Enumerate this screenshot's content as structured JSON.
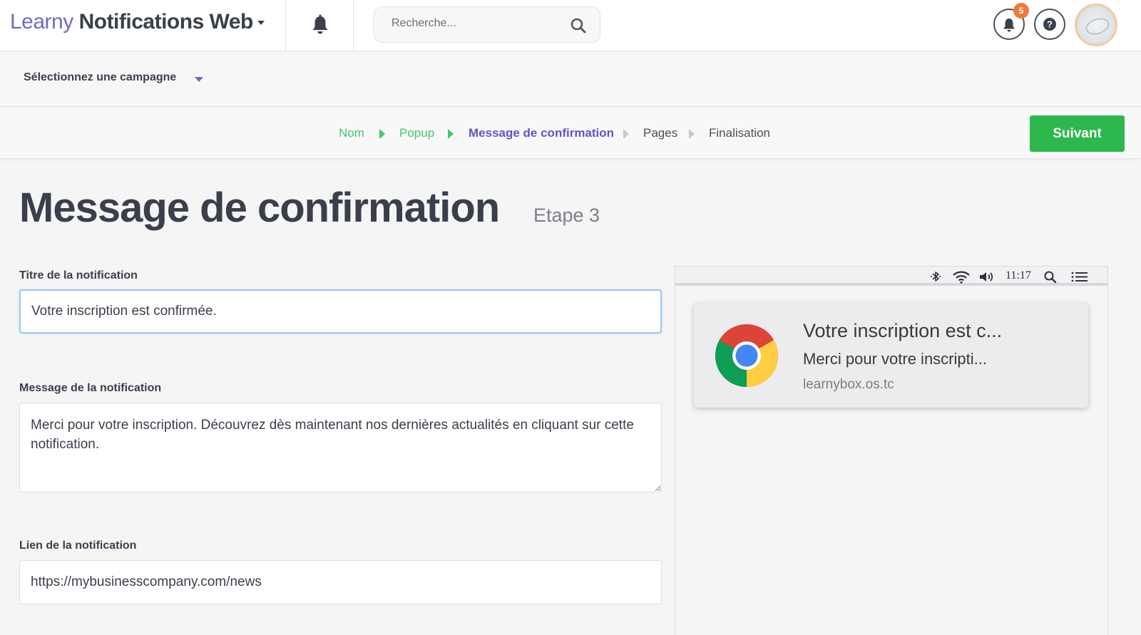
{
  "app": {
    "title_part1": "Learny",
    "title_part2": "Notifications Web",
    "search_placeholder": "Recherche...",
    "notification_count": "5",
    "accent_color": "#6e6bc9"
  },
  "campaign": {
    "select_label": "Sélectionnez une campagne"
  },
  "steps": {
    "items": [
      {
        "label": "Nom",
        "state": "done"
      },
      {
        "label": "Popup",
        "state": "done"
      },
      {
        "label": "Message de confirmation",
        "state": "active"
      },
      {
        "label": "Pages",
        "state": "todo"
      },
      {
        "label": "Finalisation",
        "state": "todo"
      }
    ],
    "next_label": "Suivant",
    "next_color": "#2db84d"
  },
  "page": {
    "title": "Message de confirmation",
    "step": "Etape 3"
  },
  "form": {
    "title_label": "Titre de la notification",
    "title_value": "Votre inscription est confirmée.",
    "message_label": "Message de la notification",
    "message_value": "Merci pour votre inscription. Découvrez dès maintenant nos dernières actualités en cliquant sur cette notification.",
    "link_label": "Lien de la notification",
    "link_value": "https://mybusinesscompany.com/news"
  },
  "preview": {
    "menubar_time": "11:17",
    "notif_title": "Votre inscription est c...",
    "notif_body": "Merci pour votre inscripti...",
    "notif_site": "learnybox.os.tc",
    "icons": [
      "bluetooth-icon",
      "wifi-icon",
      "volume-icon",
      "search-icon",
      "menu-list-icon",
      "chrome-logo"
    ]
  }
}
